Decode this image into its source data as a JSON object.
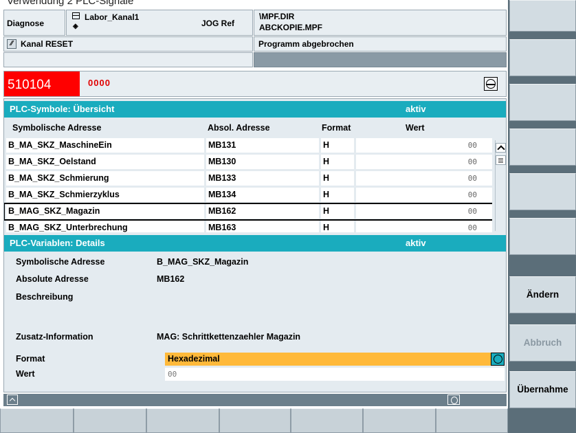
{
  "caption": "Verwendung 2 PLC-Signale",
  "header": {
    "area": "Diagnose",
    "channel_name": "Labor_Kanal1",
    "mode": "JOG Ref",
    "program_path": "\\MPF.DIR",
    "program_name": "ABCKOPIE.MPF",
    "channel_state": "Kanal RESET",
    "program_state": "Programm abgebrochen"
  },
  "alarm": {
    "number": "510104",
    "code": "0000"
  },
  "overview": {
    "title": "PLC-Symbole: Übersicht",
    "state": "aktiv",
    "columns": [
      "Symbolische Adresse",
      "Absol. Adresse",
      "Format",
      "Wert"
    ],
    "rows": [
      {
        "symbol": "B_MA_SKZ_MaschineEin",
        "address": "MB131",
        "format": "H",
        "value": "00"
      },
      {
        "symbol": "B_MA_SKZ_Oelstand",
        "address": "MB130",
        "format": "H",
        "value": "00"
      },
      {
        "symbol": "B_MA_SKZ_Schmierung",
        "address": "MB133",
        "format": "H",
        "value": "00"
      },
      {
        "symbol": "B_MA_SKZ_Schmierzyklus",
        "address": "MB134",
        "format": "H",
        "value": "00"
      },
      {
        "symbol": "B_MAG_SKZ_Magazin",
        "address": "MB162",
        "format": "H",
        "value": "00"
      },
      {
        "symbol": "B_MAG_SKZ_Unterbrechung",
        "address": "MB163",
        "format": "H",
        "value": "00"
      }
    ],
    "selected_index": 4
  },
  "details": {
    "title": "PLC-Variablen: Details",
    "state": "aktiv",
    "symbol_label": "Symbolische Adresse",
    "symbol_value": "B_MAG_SKZ_Magazin",
    "address_label": "Absolute Adresse",
    "address_value": "MB162",
    "description_label": "Beschreibung",
    "extra_label": "Zusatz-Information",
    "extra_value": "MAG: Schrittkettenzaehler Magazin",
    "format_label": "Format",
    "format_value": "Hexadezimal",
    "value_label": "Wert",
    "value_value": "00"
  },
  "softkeys": {
    "vertical": [
      "",
      "",
      "",
      "",
      "",
      "",
      "Ändern",
      "Abbruch",
      "Übernahme"
    ],
    "vertical_disabled": [
      false,
      false,
      false,
      false,
      false,
      false,
      false,
      true,
      false
    ]
  },
  "icons": {
    "channel": "window-icon",
    "reset": "reset-icon",
    "alarm": "alarm-cancel-icon",
    "scroll_up": "chevron-up-icon",
    "format_toggle": "toggle-icon",
    "recall": "recall-icon",
    "etc": "etc-icon"
  },
  "colors": {
    "alarm_bg": "#ff0000",
    "title_bar": "#1aacbe",
    "format_highlight": "#ffb93a",
    "softkey_bar": "#5b6e79"
  }
}
